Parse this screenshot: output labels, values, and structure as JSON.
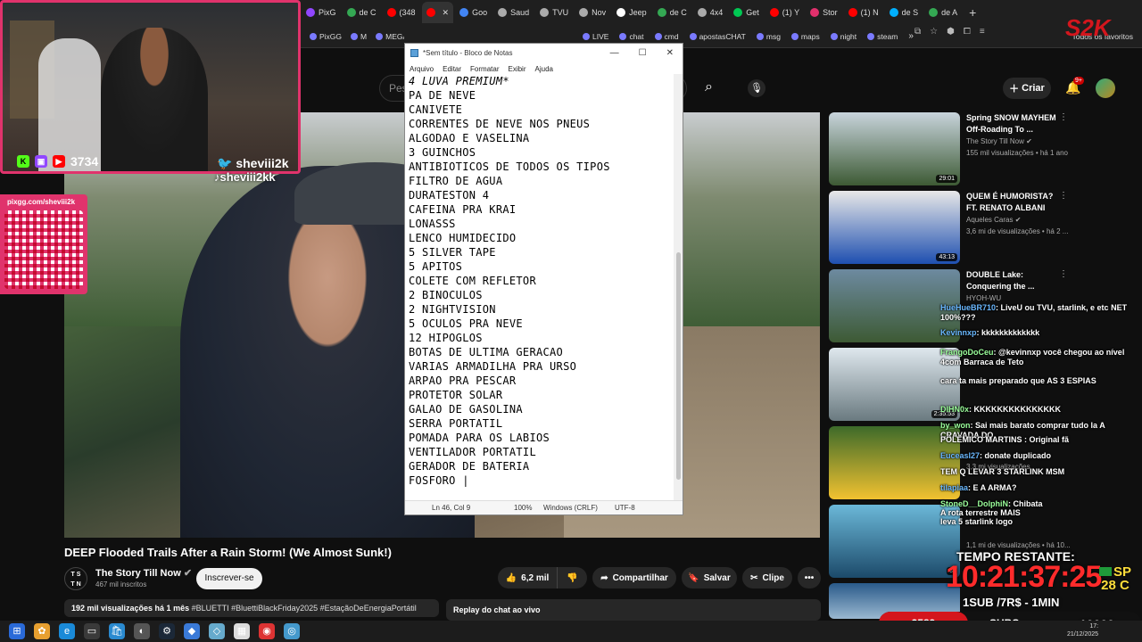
{
  "browser": {
    "tabs": [
      {
        "label": "PixG",
        "color": "#9146ff"
      },
      {
        "label": "de C",
        "color": "#34a853"
      },
      {
        "label": "(348",
        "color": "#ff0000"
      },
      {
        "label": "",
        "color": "#ff0000"
      },
      {
        "label": "Goo",
        "color": "#4285f4"
      },
      {
        "label": "Saud",
        "color": "#aaaaaa"
      },
      {
        "label": "TVU",
        "color": "#aaaaaa"
      },
      {
        "label": "Nov",
        "color": "#aaaaaa"
      },
      {
        "label": "Jeep",
        "color": "#ffffff"
      },
      {
        "label": "de C",
        "color": "#34a853"
      },
      {
        "label": "4x4",
        "color": "#aaaaaa"
      },
      {
        "label": "Get",
        "color": "#00c853"
      },
      {
        "label": "(1) Y",
        "color": "#ff0000"
      },
      {
        "label": "Stor",
        "color": "#e1306c"
      },
      {
        "label": "(1) N",
        "color": "#ff0000"
      },
      {
        "label": "de S",
        "color": "#00b0ff"
      },
      {
        "label": "de A",
        "color": "#34a853"
      }
    ],
    "new_tab": "+",
    "bookmarks_left": [
      "PixGG",
      "M",
      "MEGAN"
    ],
    "bookmarks_right": [
      "LIVE",
      "chat",
      "cmd",
      "apostasCHAT",
      "msg",
      "maps",
      "night",
      "steam"
    ],
    "bookmarks_more": "»",
    "bookmarks_all": "Todos os favoritos"
  },
  "youtube": {
    "search_placeholder": "Pes",
    "create_label": "Criar",
    "bell_badge": "9+",
    "video": {
      "title": "DEEP Flooded Trails After a Rain Storm! (We Almost Sunk!)",
      "channel": "The Story Till Now",
      "channel_logo": "T S\nT N",
      "subscribers": "467 mil inscritos",
      "subscribe_label": "Inscrever-se",
      "likes": "6,2 mil",
      "share_label": "Compartilhar",
      "save_label": "Salvar",
      "clip_label": "Clipe",
      "more_label": "•••",
      "views": "192 mil visualizações  há 1 mês",
      "hashtags": "#BLUETTI #BluettiBlackFriday2025 #EstaçãoDeEnergiaPortátil",
      "chat_replay": "Replay do chat ao vivo"
    },
    "recommendations": [
      {
        "title": "Spring SNOW MAYHEM Off-Roading To ...",
        "channel": "The Story Till Now ✔",
        "meta": "155 mil visualizações • há 1 ano",
        "duration": "29:01",
        "colors": [
          "#c8d4dc",
          "#3d5a34"
        ]
      },
      {
        "title": "QUEM É HUMORISTA? FT. RENATO ALBANI",
        "channel": "Aqueles Caras ✔",
        "meta": "3,6 mi de visualizações • há 2 ...",
        "duration": "43:13",
        "colors": [
          "#e8e8e8",
          "#1e4fb0"
        ]
      },
      {
        "title": "DOUBLE Lake: Conquering the ...",
        "channel": "HYOH-WU",
        "meta": "",
        "duration": "",
        "colors": [
          "#6d8aa0",
          "#3d5a34"
        ]
      },
      {
        "title": "",
        "channel": "",
        "meta": "",
        "duration": "2:35:53",
        "colors": [
          "#dfe8ee",
          "#6a7a80"
        ]
      },
      {
        "title": "",
        "channel": "",
        "meta": "3,3 mi visualizações",
        "duration": "",
        "colors": [
          "#3d6a2a",
          "#f2c230"
        ]
      },
      {
        "title": "",
        "channel": "",
        "meta": "1,1 mi de visualizações • há 10...",
        "duration": "3:",
        "colors": [
          "#6bb8d8",
          "#1c4a6a"
        ]
      },
      {
        "title": "",
        "channel": "",
        "meta": "",
        "duration": "",
        "colors": [
          "#2a5a8a",
          "#9ab8d0"
        ]
      }
    ]
  },
  "notepad": {
    "title": "*Sem título - Bloco de Notas",
    "minimize": "—",
    "maximize": "☐",
    "close": "✕",
    "menu": [
      "Arquivo",
      "Editar",
      "Formatar",
      "Exibir",
      "Ajuda"
    ],
    "lines": [
      "4 LUVA PREMIUM*",
      "PA DE NEVE",
      "CANIVETE",
      "CORRENTES DE NEVE NOS PNEUS",
      "ALGODAO E VASELINA",
      "3 GUINCHOS",
      "ANTIBIOTICOS DE TODOS OS TIPOS",
      "FILTRO DE AGUA",
      "DURATESTON 4",
      "CAFEINA PRA KRAI",
      "LONASSS",
      "LENCO HUMIDECIDO",
      "5 SILVER TAPE",
      "5 APITOS",
      "COLETE COM REFLETOR",
      "2 BINOCULOS",
      "2 NIGHTVISION",
      "5 OCULOS PRA NEVE",
      "12 HIPOGLOS",
      "BOTAS DE ULTIMA GERACAO",
      "VARIAS ARMADILHA PRA URSO",
      "ARPAO PRA PESCAR",
      "PROTETOR SOLAR",
      "GALAO DE GASOLINA",
      "SERRA PORTATIL",
      "POMADA PARA OS LABIOS",
      "VENTILADOR PORTATIL",
      "GERADOR DE BATERIA",
      "FOSFORO |"
    ],
    "status": {
      "position": "Ln 46, Col 9",
      "zoom": "100%",
      "line_ending": "Windows (CRLF)",
      "encoding": "UTF-8"
    }
  },
  "stream_overlay": {
    "viewers": "3734",
    "handle_main": "sheviii2k",
    "handle_tiktok": "sheviii2kk",
    "qr_url": "pixgg.com/sheviii2k",
    "chat": [
      {
        "user": "HueHueBR710",
        "text": ": LiveU ou TVU, starlink, e etc NET 100%???",
        "cls": "b"
      },
      {
        "user": "Kevinnxp",
        "text": ": kkkkkkkkkkkkk",
        "cls": "b"
      },
      {
        "user": "FrangoDoCeu",
        "text": ": @kevinnxp você chegou ao nível 4com Barraca de Teto",
        "cls": ""
      },
      {
        "user": "",
        "text": "cara ta mais preparado que AS 3 ESPIAS",
        "cls": ""
      },
      {
        "user": "DIHN0x",
        "text": ": KKKKKKKKKKKKKKK",
        "cls": ""
      },
      {
        "user": "by_won",
        "text": ": Sai mais barato comprar tudo la A CRAVADA DO",
        "cls": ""
      },
      {
        "user": "",
        "text": "POLÊMICO MARTINS : Original fã",
        "cls": ""
      },
      {
        "user": "Euceasl27",
        "text": ": donate duplicado",
        "cls": "b"
      },
      {
        "user": "",
        "text": "TEM Q LEVAR 3 STARLINK MSM",
        "cls": ""
      },
      {
        "user": "tilapiaa",
        "text": ": E A ARMA?",
        "cls": "b"
      },
      {
        "user": "StoneD__DolphiN",
        "text": ": Chibata",
        "cls": ""
      },
      {
        "user": "",
        "text": "A rota terrestre MAIS",
        "cls": ""
      },
      {
        "user": "",
        "text": "leva 5 starlink logo",
        "cls": ""
      }
    ],
    "timer_label": "TEMPO RESTANTE:",
    "timer": "10:21:37:25",
    "weather_state": "SP",
    "weather_temp": "28 C",
    "sub_goal": "1SUB /7R$ - 1MIN",
    "subs_count": "3589",
    "subs_label": "SUBS",
    "subs_max": "10000",
    "logo": "S2K"
  },
  "taskbar": {
    "apps": [
      "⊞",
      "✿",
      "e",
      "▭",
      "🛍",
      "◐",
      "⚙",
      "◆",
      "◇",
      "▦",
      "◉",
      "◎"
    ],
    "clock_time": "17:",
    "clock_date": "21/12/2025"
  }
}
